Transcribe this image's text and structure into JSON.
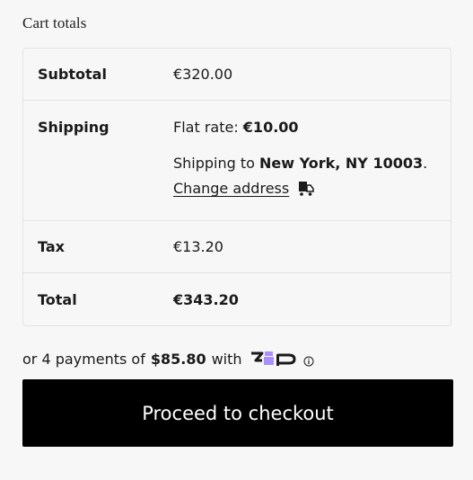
{
  "cart": {
    "heading": "Cart totals",
    "subtotal_label": "Subtotal",
    "subtotal_value": "€320.00",
    "shipping_label": "Shipping",
    "flat_rate_prefix": "Flat rate: ",
    "flat_rate_value": "€10.00",
    "shipping_to_prefix": "Shipping to ",
    "shipping_to_location": "New York, NY 10003",
    "shipping_to_suffix": ".",
    "change_address_label": "Change address",
    "tax_label": "Tax",
    "tax_value": "€13.20",
    "total_label": "Total",
    "total_value": "€343.20"
  },
  "installments": {
    "prefix": "or 4 payments of",
    "amount": "$85.80",
    "suffix": "with",
    "provider_logo": "zip-logo",
    "info_icon": "info-icon"
  },
  "checkout": {
    "button_label": "Proceed to checkout"
  },
  "icons": {
    "shipping_calculator": "truck-icon"
  },
  "colors": {
    "background": "#f7f7f7",
    "button_bg": "#000000",
    "button_text": "#ffffff",
    "zip_purple": "#aa8fff",
    "border": "#e3e3e3"
  }
}
